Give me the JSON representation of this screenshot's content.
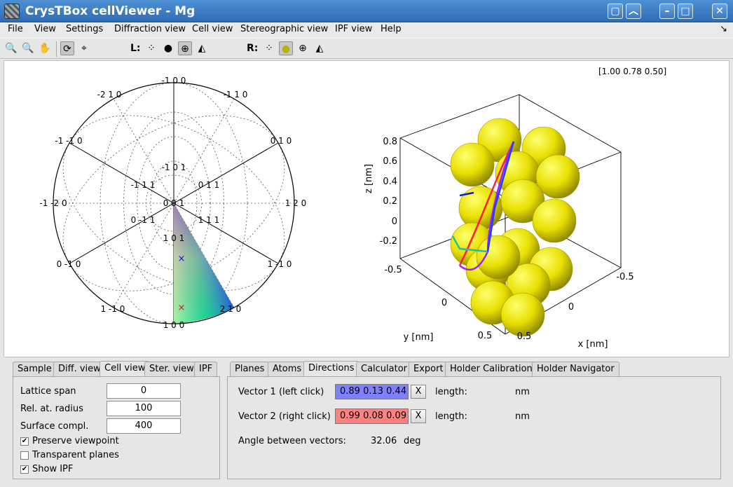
{
  "window": {
    "title": "CrysTBox cellViewer - Mg"
  },
  "menu": [
    "File",
    "View",
    "Settings",
    "Diffraction view",
    "Cell view",
    "Stereographic view",
    "IPF view",
    "Help"
  ],
  "toolbar": {
    "left_label": "L:",
    "right_label": "R:"
  },
  "stereo": {
    "labels": [
      "-1 0 0",
      "-2 1 0",
      "-1 1 0",
      "-1 -1 0",
      "0 1 0",
      "-1 0 1",
      "-1 1 1",
      "0 1 1",
      "-1 -2 0",
      "0 0 1",
      "1 2 0",
      "0 -1 1",
      "1 1 1",
      "1 0 1",
      "0 -1 0",
      "1 -1 0",
      "1 -1 0",
      "2 1 0",
      "1 0 0"
    ],
    "markers": {
      "blue": "×",
      "red": "×"
    }
  },
  "cell": {
    "coord": "[1.00 0.78 0.50]",
    "zlabel": "z [nm]",
    "ylabel": "y [nm]",
    "xlabel": "x [nm]",
    "zticks": [
      "0.8",
      "0.6",
      "0.4",
      "0.2",
      "0",
      "-0.2"
    ],
    "yticks": [
      "-0.5",
      "0",
      "0.5"
    ],
    "xticks": [
      "-0.5",
      "0",
      "0.5"
    ],
    "atom_color": "#e8e000"
  },
  "left_tabs": [
    "Sample",
    "Diff. view",
    "Cell view",
    "Ster. view",
    "IPF"
  ],
  "left_active": "Cell view",
  "cellview": {
    "lattice_span_label": "Lattice span",
    "lattice_span": "0",
    "rel_radius_label": "Rel. at. radius",
    "rel_radius": "100",
    "surface_label": "Surface compl.",
    "surface": "400",
    "preserve_label": "Preserve viewpoint",
    "preserve": true,
    "transparent_label": "Transparent planes",
    "transparent": false,
    "ipf_label": "Show IPF",
    "ipf": true
  },
  "right_tabs": [
    "Planes",
    "Atoms",
    "Directions",
    "Calculator",
    "Export",
    "Holder Calibration",
    "Holder Navigator"
  ],
  "right_active": "Directions",
  "directions": {
    "v1_label": "Vector 1 (left click)",
    "v1": "0.89 0.13 0.44",
    "v1_color": "#8080ff",
    "v2_label": "Vector 2 (right click)",
    "v2": "0.99 0.08 0.09",
    "v2_color": "#ff8080",
    "x_label": "X",
    "length_label": "length:",
    "unit": "nm",
    "angle_label": "Angle between vectors:",
    "angle": "32.06",
    "angle_unit": "deg"
  }
}
